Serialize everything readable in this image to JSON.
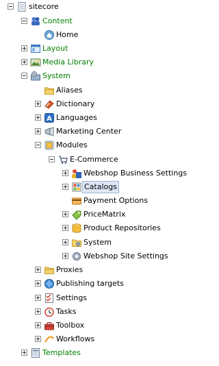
{
  "tree": {
    "items": [
      {
        "label": "sitecore",
        "icon": "sitecore-root-icon",
        "expander": "minus"
      },
      {
        "label": "Content",
        "icon": "content-icon",
        "expander": "minus",
        "color": "green"
      },
      {
        "label": "Home",
        "icon": "home-icon",
        "expander": ""
      },
      {
        "label": "Layout",
        "icon": "layout-icon",
        "expander": "plus",
        "color": "green"
      },
      {
        "label": "Media Library",
        "icon": "media-library-icon",
        "expander": "plus",
        "color": "green"
      },
      {
        "label": "System",
        "icon": "system-icon",
        "expander": "minus",
        "color": "green"
      },
      {
        "label": "Aliases",
        "icon": "aliases-folder-icon",
        "expander": ""
      },
      {
        "label": "Dictionary",
        "icon": "dictionary-icon",
        "expander": "plus"
      },
      {
        "label": "Languages",
        "icon": "languages-icon",
        "expander": "plus"
      },
      {
        "label": "Marketing Center",
        "icon": "marketing-center-icon",
        "expander": "plus"
      },
      {
        "label": "Modules",
        "icon": "modules-icon",
        "expander": "minus"
      },
      {
        "label": "E-Commerce",
        "icon": "e-commerce-icon",
        "expander": "minus"
      },
      {
        "label": "Webshop Business Settings",
        "icon": "business-settings-icon",
        "expander": "plus"
      },
      {
        "label": "Catalogs",
        "icon": "catalogs-icon",
        "expander": "plus",
        "selected": true
      },
      {
        "label": "Payment Options",
        "icon": "payment-options-icon",
        "expander": ""
      },
      {
        "label": "PriceMatrix",
        "icon": "pricematrix-icon",
        "expander": "plus"
      },
      {
        "label": "Product Repositories",
        "icon": "product-repositories-icon",
        "expander": "plus"
      },
      {
        "label": "System",
        "icon": "system-folder-icon",
        "expander": "plus"
      },
      {
        "label": "Webshop Site Settings",
        "icon": "site-settings-icon",
        "expander": "plus"
      },
      {
        "label": "Proxies",
        "icon": "proxies-folder-icon",
        "expander": "plus"
      },
      {
        "label": "Publishing targets",
        "icon": "publishing-targets-icon",
        "expander": "plus"
      },
      {
        "label": "Settings",
        "icon": "settings-icon",
        "expander": "plus"
      },
      {
        "label": "Tasks",
        "icon": "tasks-icon",
        "expander": "plus"
      },
      {
        "label": "Toolbox",
        "icon": "toolbox-icon",
        "expander": "plus"
      },
      {
        "label": "Workflows",
        "icon": "workflows-icon",
        "expander": "plus"
      },
      {
        "label": "Templates",
        "icon": "templates-icon",
        "expander": "plus",
        "color": "green"
      }
    ]
  }
}
